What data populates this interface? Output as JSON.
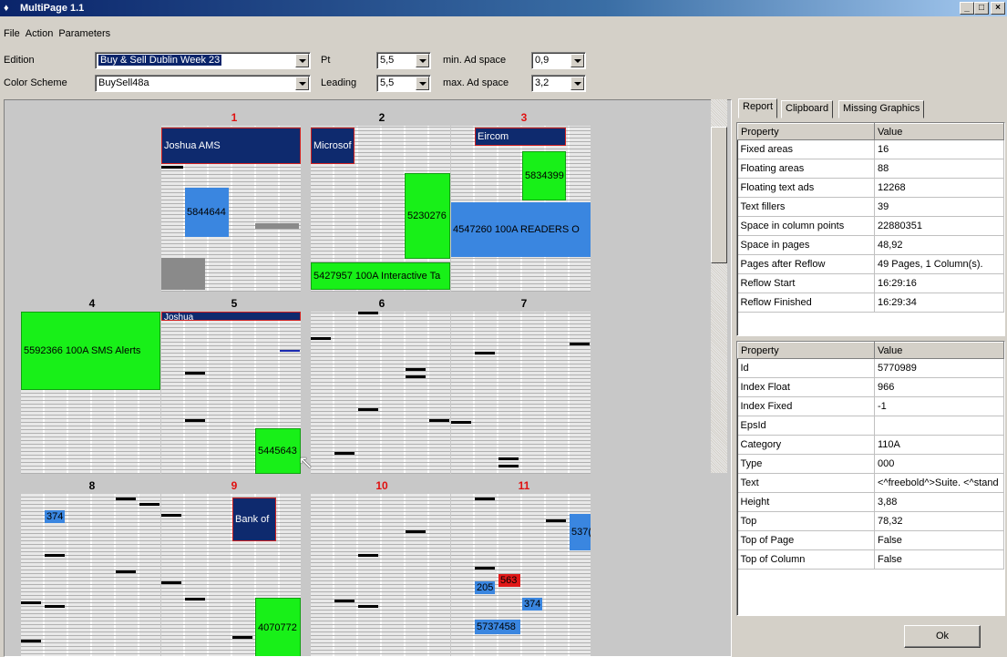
{
  "window": {
    "title": "MultiPage 1.1"
  },
  "menu": [
    "File",
    "Action",
    "Parameters"
  ],
  "params": {
    "edition_label": "Edition",
    "edition_value": "Buy & Sell Dublin Week 23",
    "color_scheme_label": "Color Scheme",
    "color_scheme_value": "BuySell48a",
    "pt_label": "Pt",
    "pt_value": "5,5",
    "leading_label": "Leading",
    "leading_value": "5,5",
    "min_ad_label": "min. Ad space",
    "min_ad_value": "0,9",
    "max_ad_label": "max. Ad space",
    "max_ad_value": "3,2"
  },
  "pages": {
    "nums": [
      "1",
      "2",
      "3",
      "4",
      "5",
      "6",
      "7",
      "8",
      "9",
      "10",
      "11"
    ],
    "ads": [
      "Joshua AMS",
      "Microsof",
      "Eircom",
      "5834399",
      "5844644",
      "5230276",
      "4547260 100A READERS O",
      "5427957 100A Interactive Ta",
      "5592366 100A SMS Alerts",
      "Joshua",
      "5445643",
      "374",
      "Bank of",
      "4070772",
      "537(",
      "205",
      "563",
      "374",
      "5737458"
    ]
  },
  "tabs": [
    "Report",
    "Clipboard",
    "Missing Graphics"
  ],
  "report": {
    "header": [
      "Property",
      "Value"
    ],
    "rows": [
      [
        "Fixed areas",
        "16"
      ],
      [
        "Floating areas",
        "88"
      ],
      [
        "Floating text ads",
        "12268"
      ],
      [
        "Text fillers",
        "39"
      ],
      [
        "Space in column points",
        "22880351"
      ],
      [
        "Space in pages",
        "48,92"
      ],
      [
        "Pages after Reflow",
        "49 Pages, 1 Column(s)."
      ],
      [
        "Reflow Start",
        "16:29:16"
      ],
      [
        "Reflow Finished",
        "16:29:34"
      ]
    ]
  },
  "details": {
    "header": [
      "Property",
      "Value"
    ],
    "rows": [
      [
        "Id",
        "5770989"
      ],
      [
        "Index Float",
        "966"
      ],
      [
        "Index Fixed",
        "-1"
      ],
      [
        "EpsId",
        ""
      ],
      [
        "Category",
        "110A"
      ],
      [
        "Type",
        "000"
      ],
      [
        "Text",
        "<^freebold^>Suite. <^stand"
      ],
      [
        "Height",
        "3,88"
      ],
      [
        "Top",
        "78,32"
      ],
      [
        "Top of Page",
        "False"
      ],
      [
        "Top of Column",
        "False"
      ]
    ]
  },
  "ok_label": "Ok",
  "colors": {
    "ad_navy": "#0e2a6e",
    "ad_green": "#18f018",
    "ad_blue": "#3a86e0",
    "ad_red": "#e01818",
    "page_num_red": "#e01010"
  }
}
